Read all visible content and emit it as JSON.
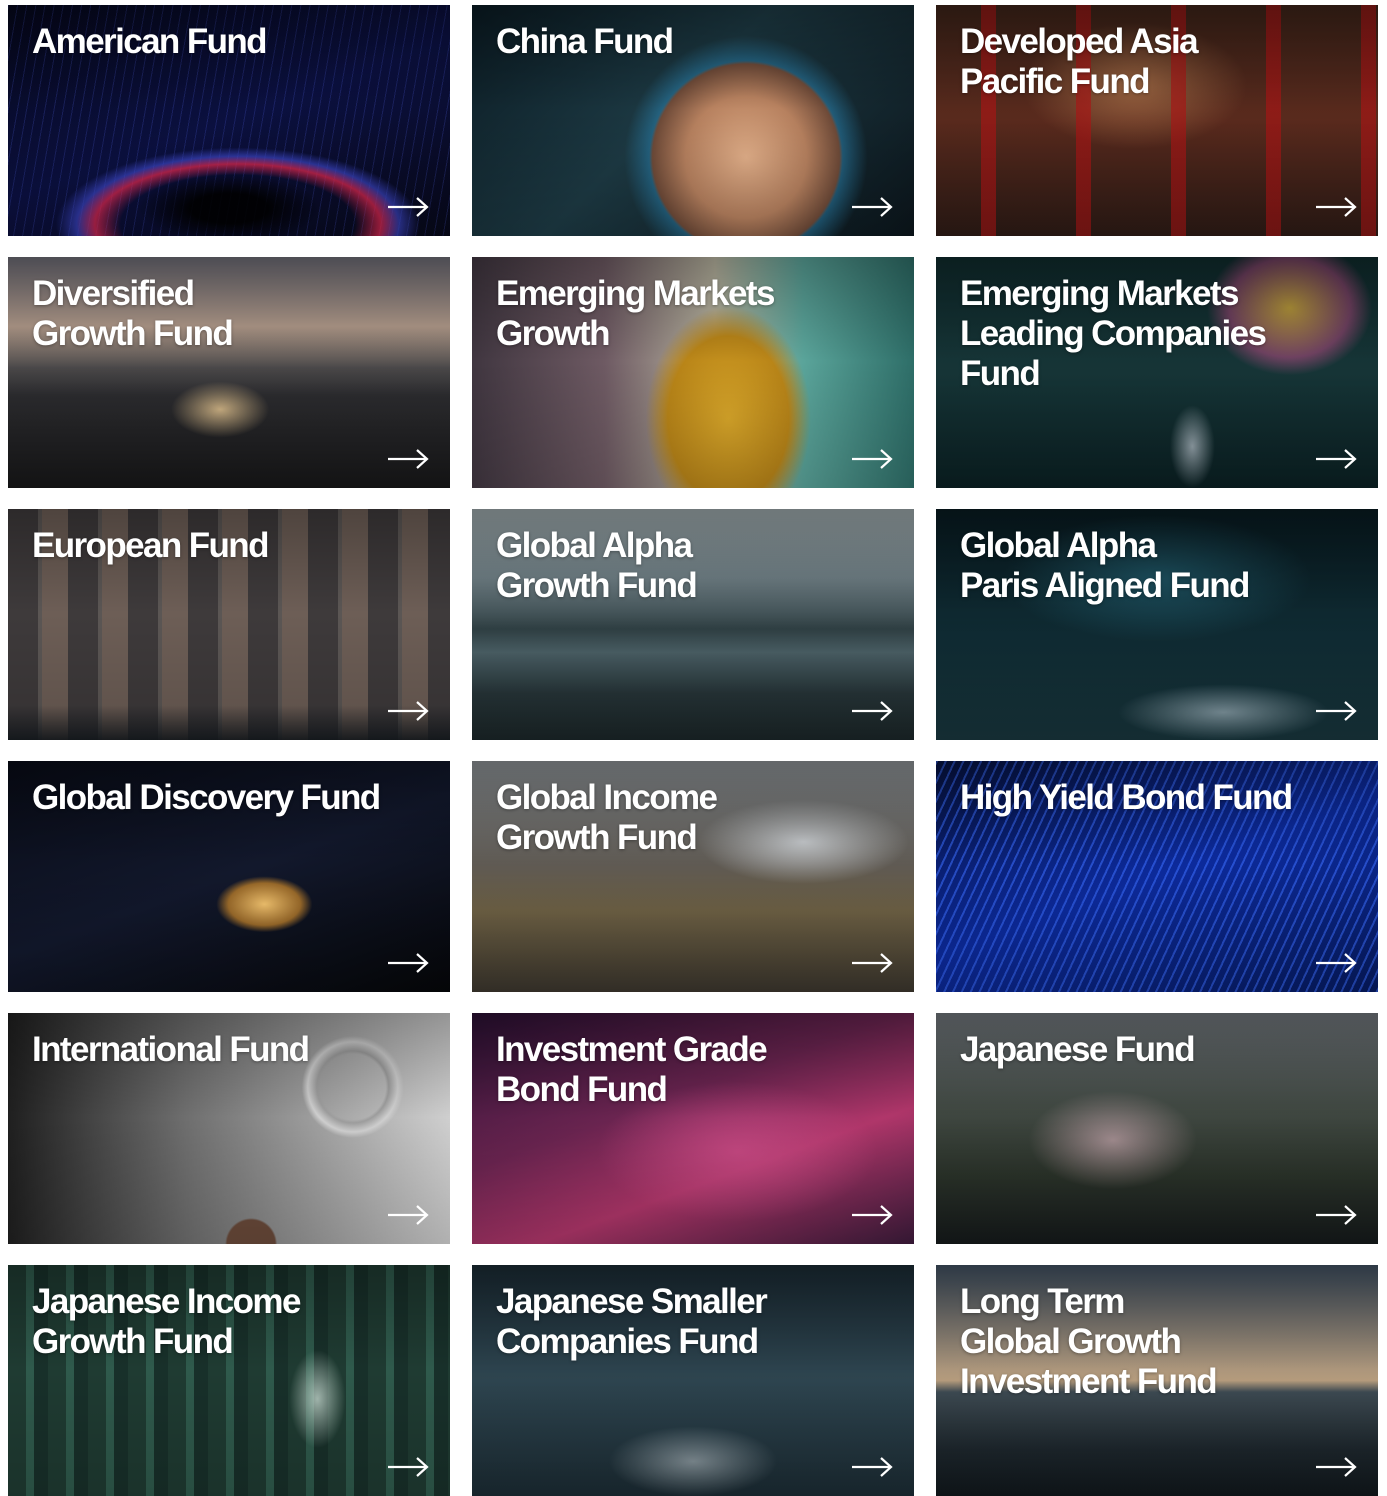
{
  "funds": [
    {
      "title": "American Fund",
      "bg": "bg-american",
      "name": "fund-card-american"
    },
    {
      "title": "China Fund",
      "bg": "bg-china",
      "name": "fund-card-china"
    },
    {
      "title": "Developed Asia\nPacific Fund",
      "bg": "bg-asia",
      "name": "fund-card-developed-asia-pacific"
    },
    {
      "title": "Diversified\nGrowth Fund",
      "bg": "bg-diversified",
      "name": "fund-card-diversified-growth"
    },
    {
      "title": "Emerging Markets\nGrowth",
      "bg": "bg-emerging-growth",
      "name": "fund-card-emerging-markets-growth"
    },
    {
      "title": "Emerging Markets\nLeading Companies\nFund",
      "bg": "bg-emerging-leading",
      "name": "fund-card-emerging-markets-leading-companies"
    },
    {
      "title": "European Fund",
      "bg": "bg-european",
      "name": "fund-card-european"
    },
    {
      "title": "Global Alpha\nGrowth Fund",
      "bg": "bg-global-alpha",
      "name": "fund-card-global-alpha-growth"
    },
    {
      "title": "Global Alpha\nParis Aligned Fund",
      "bg": "bg-paris",
      "name": "fund-card-global-alpha-paris-aligned"
    },
    {
      "title": "Global Discovery Fund",
      "bg": "bg-discovery",
      "name": "fund-card-global-discovery"
    },
    {
      "title": "Global Income\nGrowth Fund",
      "bg": "bg-income-growth",
      "name": "fund-card-global-income-growth"
    },
    {
      "title": "High Yield Bond Fund",
      "bg": "bg-high-yield",
      "name": "fund-card-high-yield-bond"
    },
    {
      "title": "International Fund",
      "bg": "bg-international",
      "name": "fund-card-international"
    },
    {
      "title": "Investment Grade\nBond Fund",
      "bg": "bg-ig-bond",
      "name": "fund-card-investment-grade-bond"
    },
    {
      "title": "Japanese Fund",
      "bg": "bg-japanese",
      "name": "fund-card-japanese"
    },
    {
      "title": "Japanese Income\nGrowth Fund",
      "bg": "bg-jp-income",
      "name": "fund-card-japanese-income-growth"
    },
    {
      "title": "Japanese Smaller\nCompanies Fund",
      "bg": "bg-jp-smaller",
      "name": "fund-card-japanese-smaller-companies"
    },
    {
      "title": "Long Term\nGlobal Growth\nInvestment Fund",
      "bg": "bg-long-term",
      "name": "fund-card-long-term-global-growth-investment"
    }
  ],
  "arrow_icon": "arrow-right-icon",
  "colors": {
    "title_text": "#ffffff",
    "page_background": "#ffffff"
  }
}
